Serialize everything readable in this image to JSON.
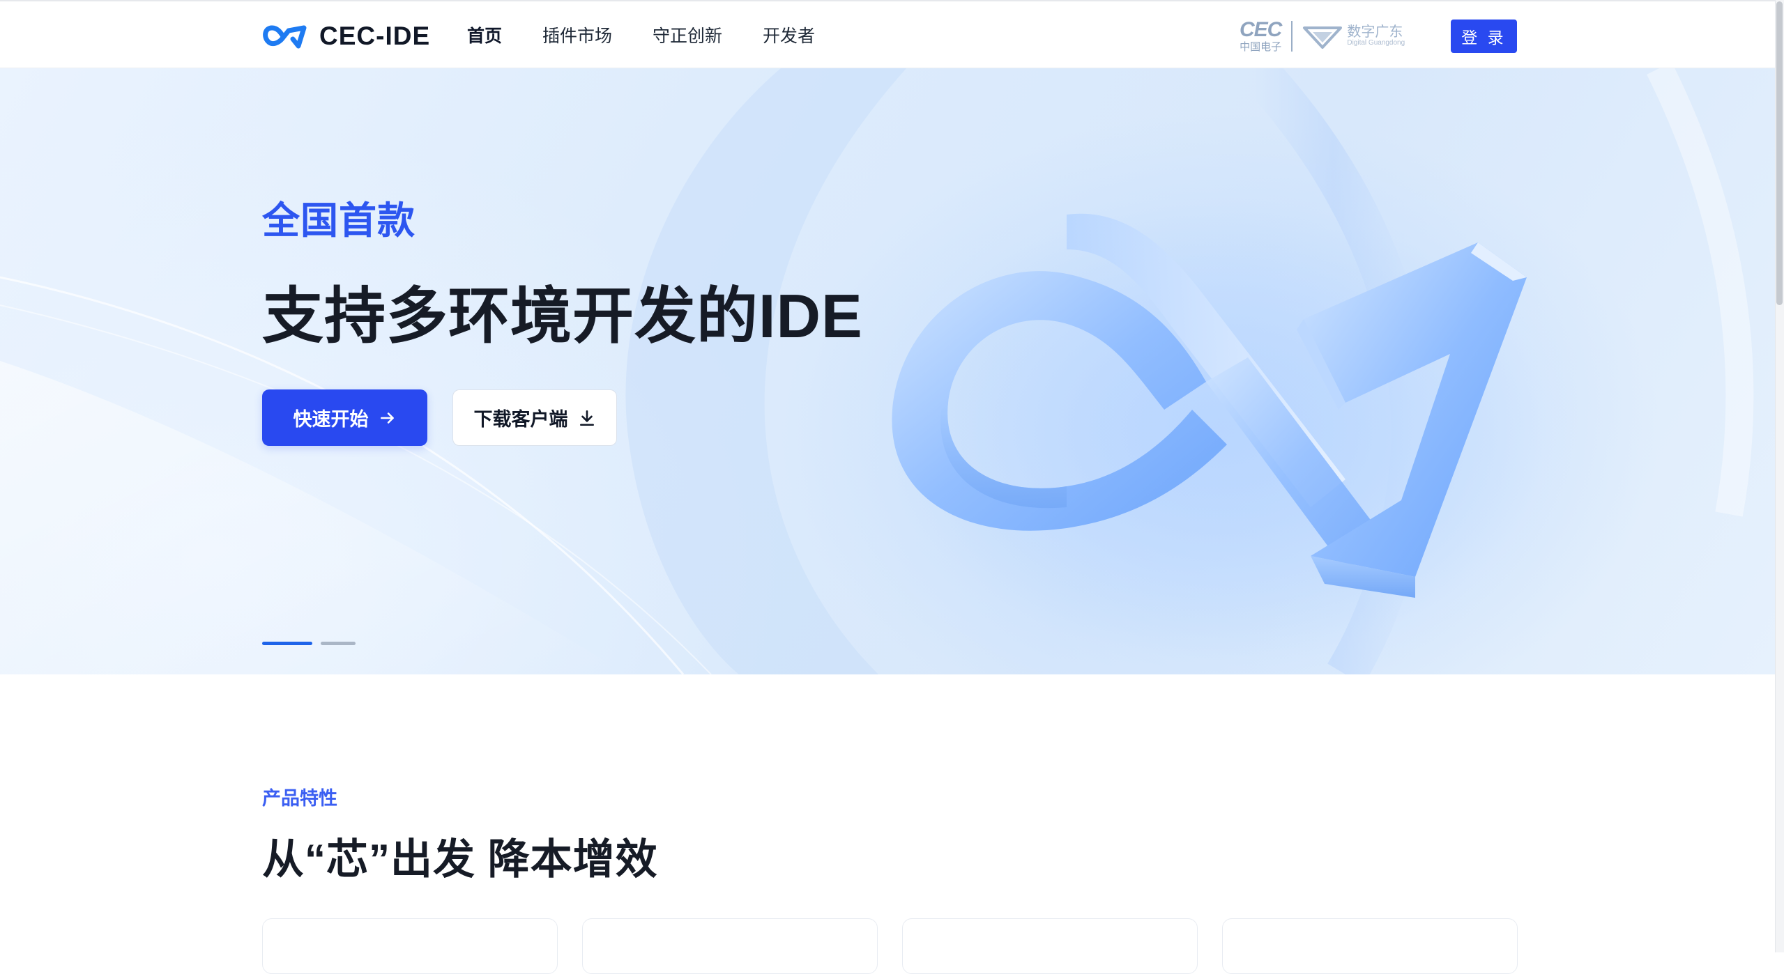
{
  "brand": {
    "name": "CEC-IDE",
    "accent": "#2949f0",
    "logo_icon": "infinity-logo-icon"
  },
  "nav": {
    "items": [
      {
        "label": "首页",
        "active": true
      },
      {
        "label": "插件市场",
        "active": false
      },
      {
        "label": "守正创新",
        "active": false
      },
      {
        "label": "开发者",
        "active": false
      }
    ]
  },
  "partners": {
    "cec": {
      "mark": "CEC",
      "subtitle": "中国电子"
    },
    "digital_guangdong": {
      "name": "数字广东",
      "subtitle": "Digital Guangdong",
      "icon": "digital-guangdong-emblem-icon"
    }
  },
  "header": {
    "login_label": "登 录"
  },
  "hero": {
    "eyebrow": "全国首款",
    "title": "支持多环境开发的IDE",
    "primary_button": "快速开始",
    "primary_icon": "arrow-right-icon",
    "secondary_button": "下载客户端",
    "secondary_icon": "download-icon",
    "carousel": {
      "total_slides": 2,
      "active_slide": 1
    }
  },
  "features": {
    "eyebrow": "产品特性",
    "title": "从“芯”出发 降本增效",
    "cards_visible": 4
  }
}
